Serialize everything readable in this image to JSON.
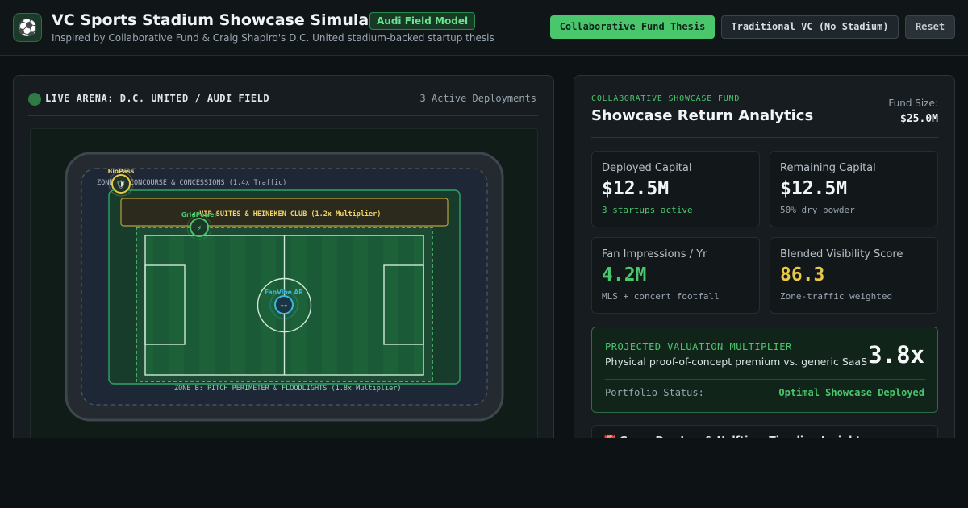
{
  "header": {
    "logo_icon": "soccer-ball-icon",
    "logo_glyph": "⚽",
    "title": "VC Sports Stadium Showcase Simulator",
    "badge": "Audi Field Model",
    "subtitle": "Inspired by Collaborative Fund & Craig Shapiro's D.C. United stadium-backed startup thesis",
    "buttons": {
      "collaborative": "Collaborative Fund Thesis",
      "traditional": "Traditional VC (No Stadium)",
      "reset": "Reset"
    }
  },
  "arena": {
    "title": "LIVE ARENA: D.C. UNITED / AUDI FIELD",
    "deployments": "3 Active Deployments",
    "zones": {
      "a": "ZONE A: CONCOURSE & CONCESSIONS (1.4x Traffic)",
      "vip": "★ VIP SUITES & HEINEKEN CLUB (1.2x Multiplier)",
      "b": "ZONE B: PITCH PERIMETER & FLOODLIGHTS (1.8x Multiplier)"
    },
    "startups": [
      {
        "name": "BioPass",
        "icon": "shield-icon",
        "glyph": "🛡",
        "color": "#e3c84a"
      },
      {
        "name": "GridPower",
        "icon": "lightning-icon",
        "glyph": "⚡",
        "color": "#4ac66d"
      },
      {
        "name": "FanVibe AR",
        "icon": "ar-goggles-icon",
        "glyph": "👓",
        "color": "#3fb4e0"
      }
    ]
  },
  "fund": {
    "eyebrow": "COLLABORATIVE SHOWCASE FUND",
    "title": "Showcase Return Analytics",
    "size_label": "Fund Size:",
    "size_value": "$25.0M",
    "cards": [
      {
        "label": "Deployed Capital",
        "value": "$12.5M",
        "sub": "3 startups active",
        "value_color": "#f2f5f7",
        "sub_color": "#4ac66d"
      },
      {
        "label": "Remaining Capital",
        "value": "$12.5M",
        "sub": "50% dry powder",
        "value_color": "#f2f5f7",
        "sub_color": "#9aa6b0"
      },
      {
        "label": "Fan Impressions / Yr",
        "value": "4.2M",
        "sub": "MLS + concert footfall",
        "value_color": "#4ac66d",
        "sub_color": "#9aa6b0"
      },
      {
        "label": "Blended Visibility Score",
        "value": "86.3",
        "sub": "Zone-traffic weighted",
        "value_color": "#e8c84a",
        "sub_color": "#9aa6b0"
      }
    ],
    "multiplier": {
      "label": "PROJECTED VALUATION MULTIPLIER",
      "desc": "Physical proof-of-concept premium vs. generic SaaS",
      "value": "3.8x",
      "status_label": "Portfolio Status:",
      "status_value": "Optimal Showcase Deployed"
    },
    "next": {
      "icon": "calendar-icon",
      "text": "📅 Game Day Log & Halftime Timeline Insights"
    }
  }
}
